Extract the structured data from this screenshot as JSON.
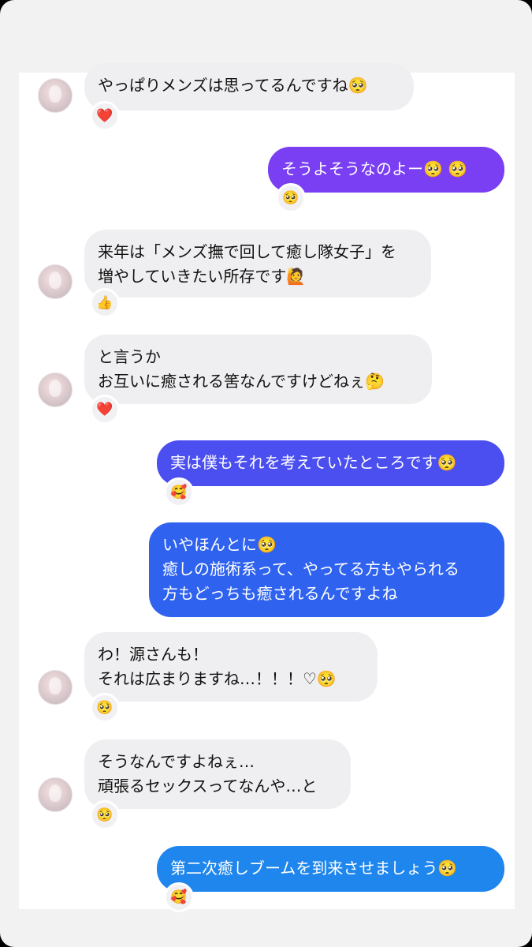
{
  "messages": [
    {
      "dir": "in",
      "lines": [
        "やっぱりメンズは思ってるんですね🥺"
      ],
      "reaction": "❤️"
    },
    {
      "dir": "out",
      "lines": [
        "そうよそうなのよー🥺 🥺"
      ],
      "reaction": "🥺",
      "color": "#7a3ff2"
    },
    {
      "dir": "in",
      "lines": [
        "来年は「メンズ撫で回して癒し隊女子」を",
        "増やしていきたい所存です🙋"
      ],
      "reaction": "👍"
    },
    {
      "dir": "in",
      "lines": [
        "と言うか",
        "お互いに癒される筈なんですけどねぇ🤔"
      ],
      "reaction": "❤️"
    },
    {
      "dir": "out",
      "lines": [
        "実は僕もそれを考えていたところです🥺"
      ],
      "reaction": "🥰",
      "color": "#4b4ff0"
    },
    {
      "dir": "out",
      "lines": [
        "いやほんとに🥺",
        "癒しの施術系って、やってる方もやられる",
        "方もどっちも癒されるんですよね"
      ],
      "color": "#2f63ef"
    },
    {
      "dir": "in",
      "lines": [
        "わ！源さんも！",
        "それは広まりますね…！！！♡🥺"
      ],
      "reaction": "🥺"
    },
    {
      "dir": "in",
      "lines": [
        "そうなんですよねぇ…",
        "頑張るセックスってなんや…と"
      ],
      "reaction": "🥺"
    },
    {
      "dir": "out",
      "lines": [
        "第二次癒しブームを到来させましょう🥺"
      ],
      "reaction": "🥰",
      "color": "#1e86ec"
    }
  ]
}
